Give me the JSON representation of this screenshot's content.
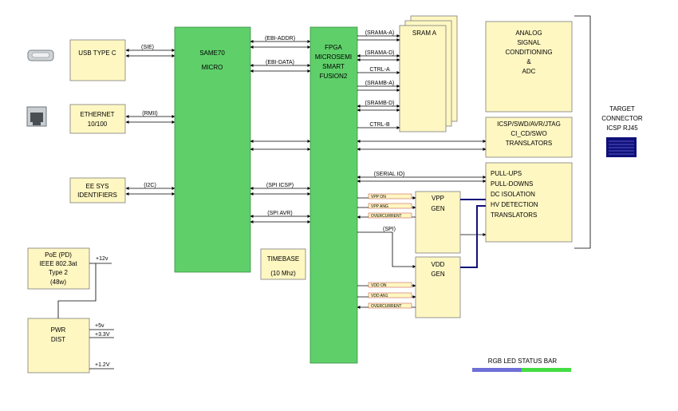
{
  "blocks": {
    "usb": "USB TYPE C",
    "ethernet": [
      "ETHERNET",
      "10/100"
    ],
    "eesys": [
      "EE SYS",
      "IDENTIFIERS"
    ],
    "poe": [
      "PoE (PD)",
      "IEEE 802.3at",
      "Type 2",
      "(48w)"
    ],
    "pwr": [
      "PWR",
      "DIST"
    ],
    "same70": [
      "SAME70",
      "MICRO"
    ],
    "timebase": [
      "TIMEBASE",
      "(10 Mhz)"
    ],
    "fpga": [
      "FPGA",
      "MICROSEMI",
      "SMART",
      "FUSION2"
    ],
    "sram": "SRAM A",
    "analog": [
      "ANALOG",
      "SIGNAL",
      "CONDITIONING",
      "&",
      "ADC"
    ],
    "icsp": [
      "ICSP/SWD/AVR/JTAG",
      "CI_CD/SWO",
      "TRANSLATORS"
    ],
    "pullups": [
      "PULL-UPS",
      "PULL-DOWNS",
      "DC ISOLATION",
      "HV DETECTION",
      "TRANSLATORS"
    ],
    "vpp": [
      "VPP",
      "GEN"
    ],
    "vdd": [
      "VDD",
      "GEN"
    ],
    "target": [
      "TARGET",
      "CONNECTOR",
      "ICSP RJ45"
    ]
  },
  "signals": {
    "sie": "(SIE)",
    "rmii": "(RMII)",
    "i2c": "(I2C)",
    "ebi_addr": "(EBI-ADDR)",
    "ebi_data": "(EBI-DATA)",
    "spi_icsp": "(SPI ICSP)",
    "spi_avr": "(SPI AVR)",
    "srama_a": "(SRAMA-A)",
    "srama_d": "(SRAMA-D)",
    "ctrl_a": "CTRL-A",
    "sramb_a": "(SRAMB-A)",
    "sramb_d": "(SRAMB-D)",
    "ctrl_b": "CTRL-B",
    "serial_io": "(SERIAL IO)",
    "spi": "(SPI)",
    "vpp_on": "VPP ON",
    "vpp_ang": "VPP ANG",
    "overcurrent": "OVERCURRENT",
    "vdd_on": "VDD ON",
    "vdd_an1": "VDD AN1"
  },
  "rails": {
    "v12": "+12v",
    "v5": "+5v",
    "v33": "+3.3V",
    "v12b": "+1.2V"
  },
  "legend": {
    "label": "RGB LED STATUS BAR",
    "colors": [
      "#6f6fd8",
      "#44dd44"
    ]
  },
  "colors": {
    "box_yellow": "#fff7c2",
    "box_green": "#5fcf6a",
    "rj45": "#10107a"
  }
}
